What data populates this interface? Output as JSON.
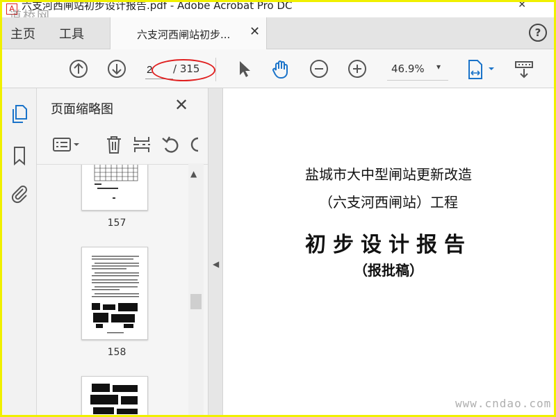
{
  "titlebar": {
    "title": "六支河西闸站初步设计报告.pdf - Adobe Acrobat Pro DC",
    "watermark": "道桥网",
    "close_glyph": "✕"
  },
  "tabs": {
    "home": "主页",
    "tools": "工具",
    "document": "六支河西闸站初步...",
    "close_glyph": "✕",
    "help_glyph": "?"
  },
  "toolbar": {
    "current_page": "2",
    "total_pages": "/ 315",
    "zoom": "46.9%",
    "zoom_caret": "▾"
  },
  "thumbnails": {
    "panel_title": "页面缩略图",
    "close_glyph": "✕",
    "pages": [
      "157",
      "158"
    ]
  },
  "document": {
    "line1": "盐城市大中型闸站更新改造",
    "line2": "（六支河西闸站）工程",
    "title": "初步设计报告",
    "subtitle": "（报批稿）"
  },
  "watermark_url": "www.cndao.com",
  "colors": {
    "accent": "#1a73c9",
    "annotation": "#e02020",
    "icon_gray": "#555555"
  }
}
